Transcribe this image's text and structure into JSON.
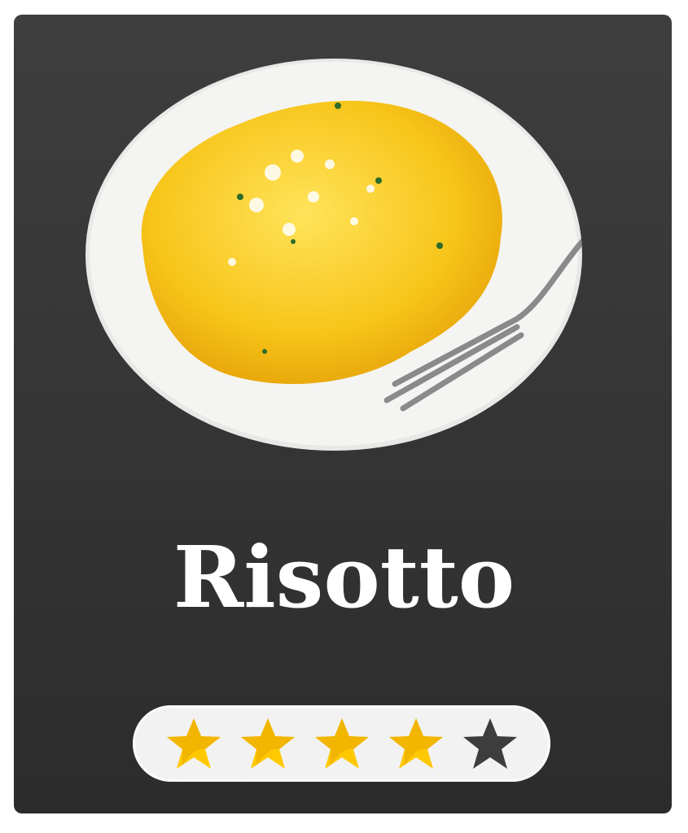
{
  "dish": {
    "title": "Risotto",
    "image": "risotto-plate-photo"
  },
  "rating": {
    "value": 4,
    "max": 5,
    "filled_color": "#ffc800",
    "empty_color": "#3d3d3d"
  }
}
